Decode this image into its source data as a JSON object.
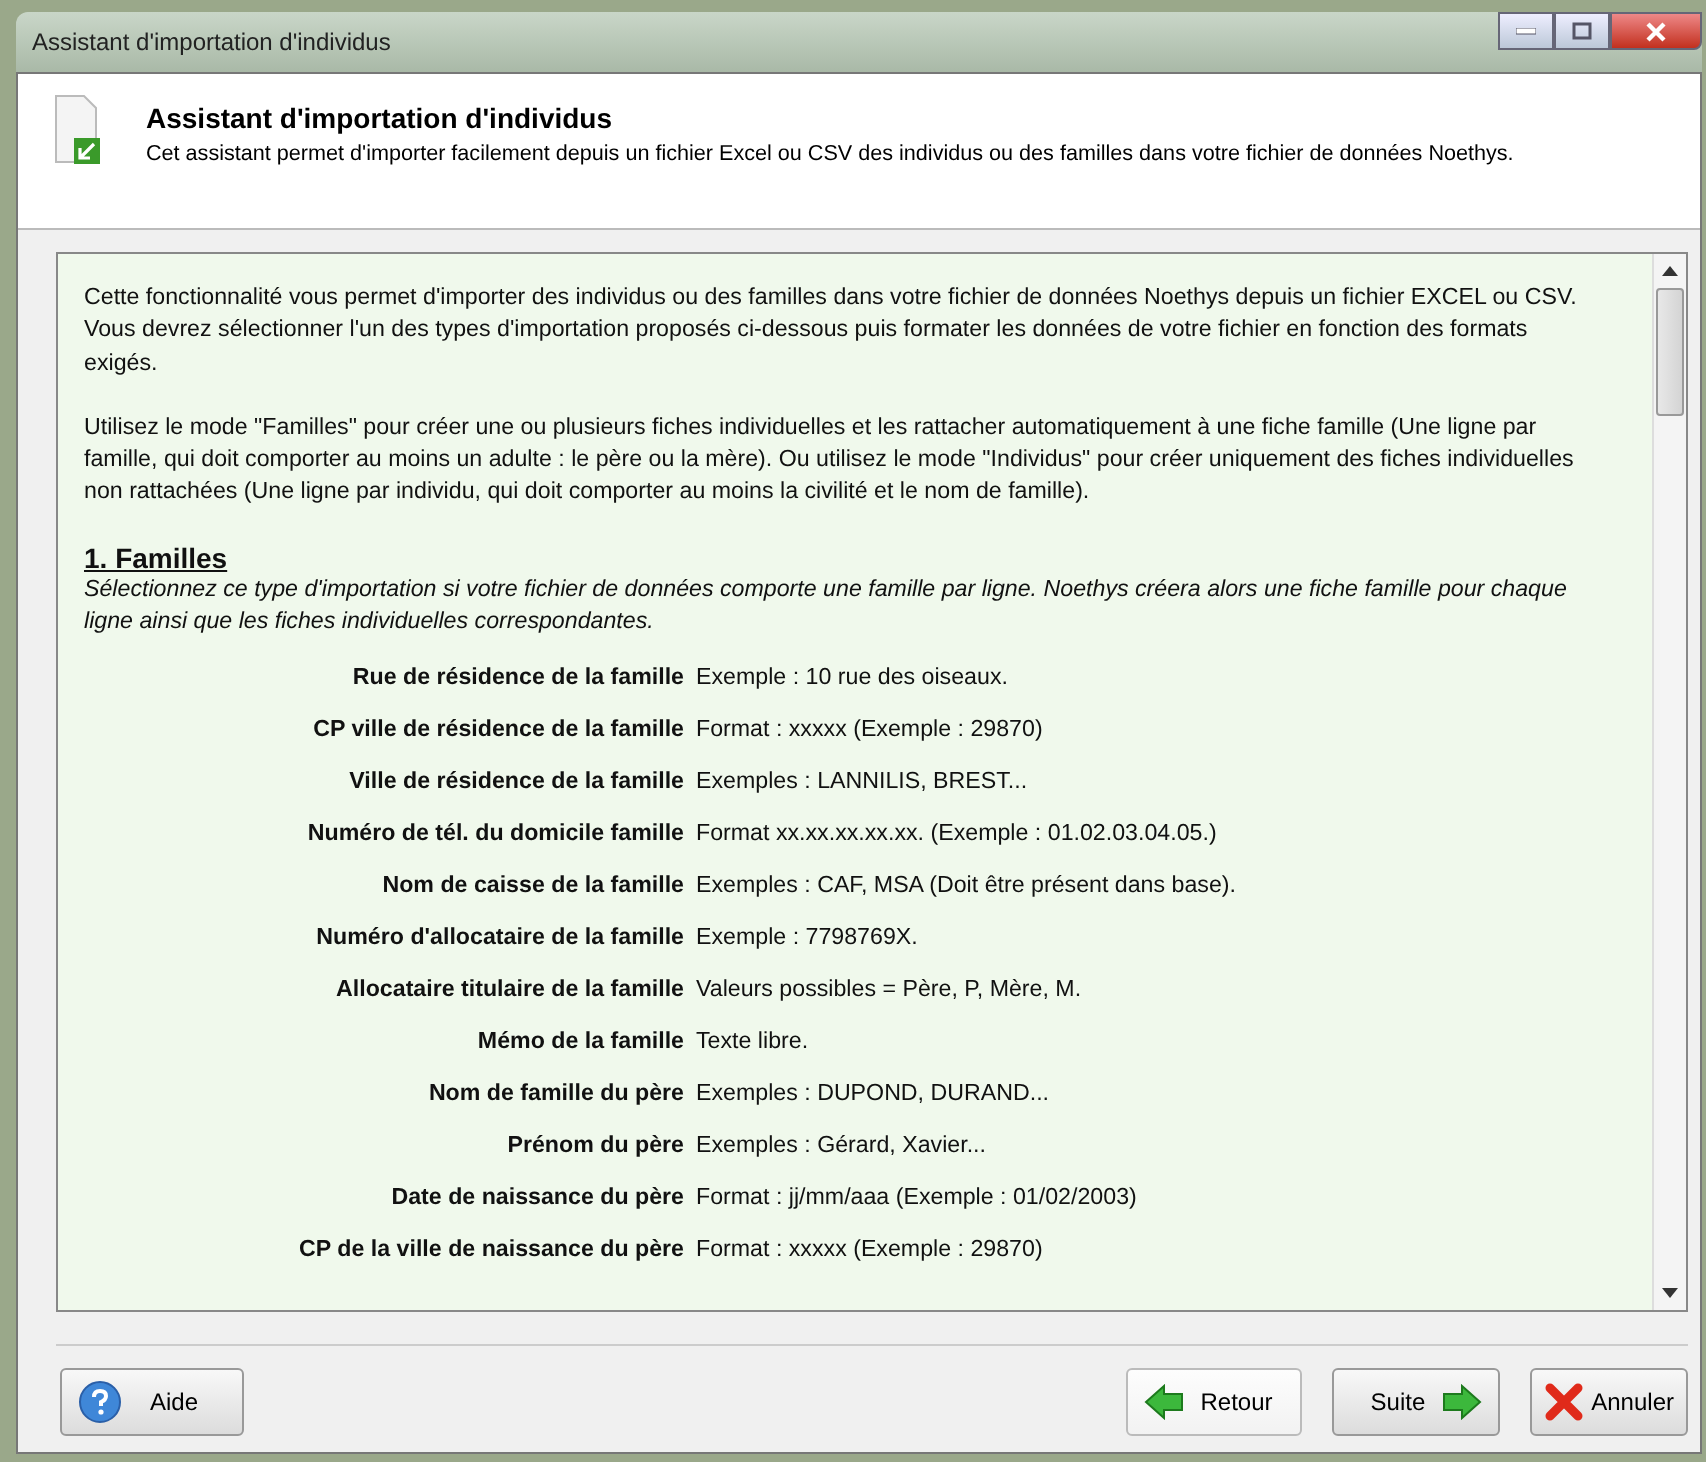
{
  "window": {
    "title": "Assistant d'importation d'individus"
  },
  "header": {
    "title": "Assistant d'importation d'individus",
    "subtitle": "Cet assistant permet d'importer facilement depuis un fichier Excel ou CSV des individus ou des familles dans votre fichier de données Noethys."
  },
  "intro": [
    "Cette fonctionnalité vous permet d'importer des individus ou des familles dans votre fichier de données Noethys depuis un fichier EXCEL ou CSV. Vous devrez sélectionner l'un des types d'importation proposés ci-dessous puis formater les données de votre fichier en fonction des formats exigés.",
    "Utilisez le mode \"Familles\" pour créer une ou plusieurs fiches individuelles et les rattacher automatiquement à une fiche famille (Une ligne par famille, qui doit comporter au moins un adulte : le père ou la mère). Ou utilisez le mode \"Individus\" pour créer uniquement des fiches individuelles non rattachées (Une ligne par individu, qui doit comporter au moins la civilité et le nom de famille)."
  ],
  "section": {
    "title": "1. Familles",
    "description": "Sélectionnez ce type d'importation si votre fichier de données comporte une famille par ligne. Noethys créera alors une fiche famille pour chaque ligne ainsi que les fiches individuelles correspondantes.",
    "fields": [
      {
        "label": "Rue de résidence de la famille",
        "format": "Exemple : 10 rue des oiseaux."
      },
      {
        "label": "CP ville de résidence de la famille",
        "format": "Format : xxxxx (Exemple : 29870)"
      },
      {
        "label": "Ville de résidence de la famille",
        "format": "Exemples : LANNILIS, BREST..."
      },
      {
        "label": "Numéro de tél. du domicile famille",
        "format": "Format xx.xx.xx.xx.xx. (Exemple : 01.02.03.04.05.)"
      },
      {
        "label": "Nom de caisse de la famille",
        "format": "Exemples : CAF, MSA (Doit être présent dans base)."
      },
      {
        "label": "Numéro d'allocataire de la famille",
        "format": "Exemple : 7798769X."
      },
      {
        "label": "Allocataire titulaire de la famille",
        "format": "Valeurs possibles = Père, P, Mère, M."
      },
      {
        "label": "Mémo de la famille",
        "format": "Texte libre."
      },
      {
        "label": "Nom de famille du père",
        "format": "Exemples : DUPOND, DURAND..."
      },
      {
        "label": "Prénom du père",
        "format": "Exemples : Gérard, Xavier..."
      },
      {
        "label": "Date de naissance du père",
        "format": "Format : jj/mm/aaa (Exemple : 01/02/2003)"
      },
      {
        "label": "CP de la ville de naissance du père",
        "format": "Format : xxxxx (Exemple : 29870)"
      }
    ]
  },
  "buttons": [
    {
      "label": "Aide",
      "kind": "help"
    },
    {
      "label": "Retour",
      "kind": "back"
    },
    {
      "label": "Suite",
      "kind": "next"
    },
    {
      "label": "Annuler",
      "kind": "cancel"
    }
  ]
}
